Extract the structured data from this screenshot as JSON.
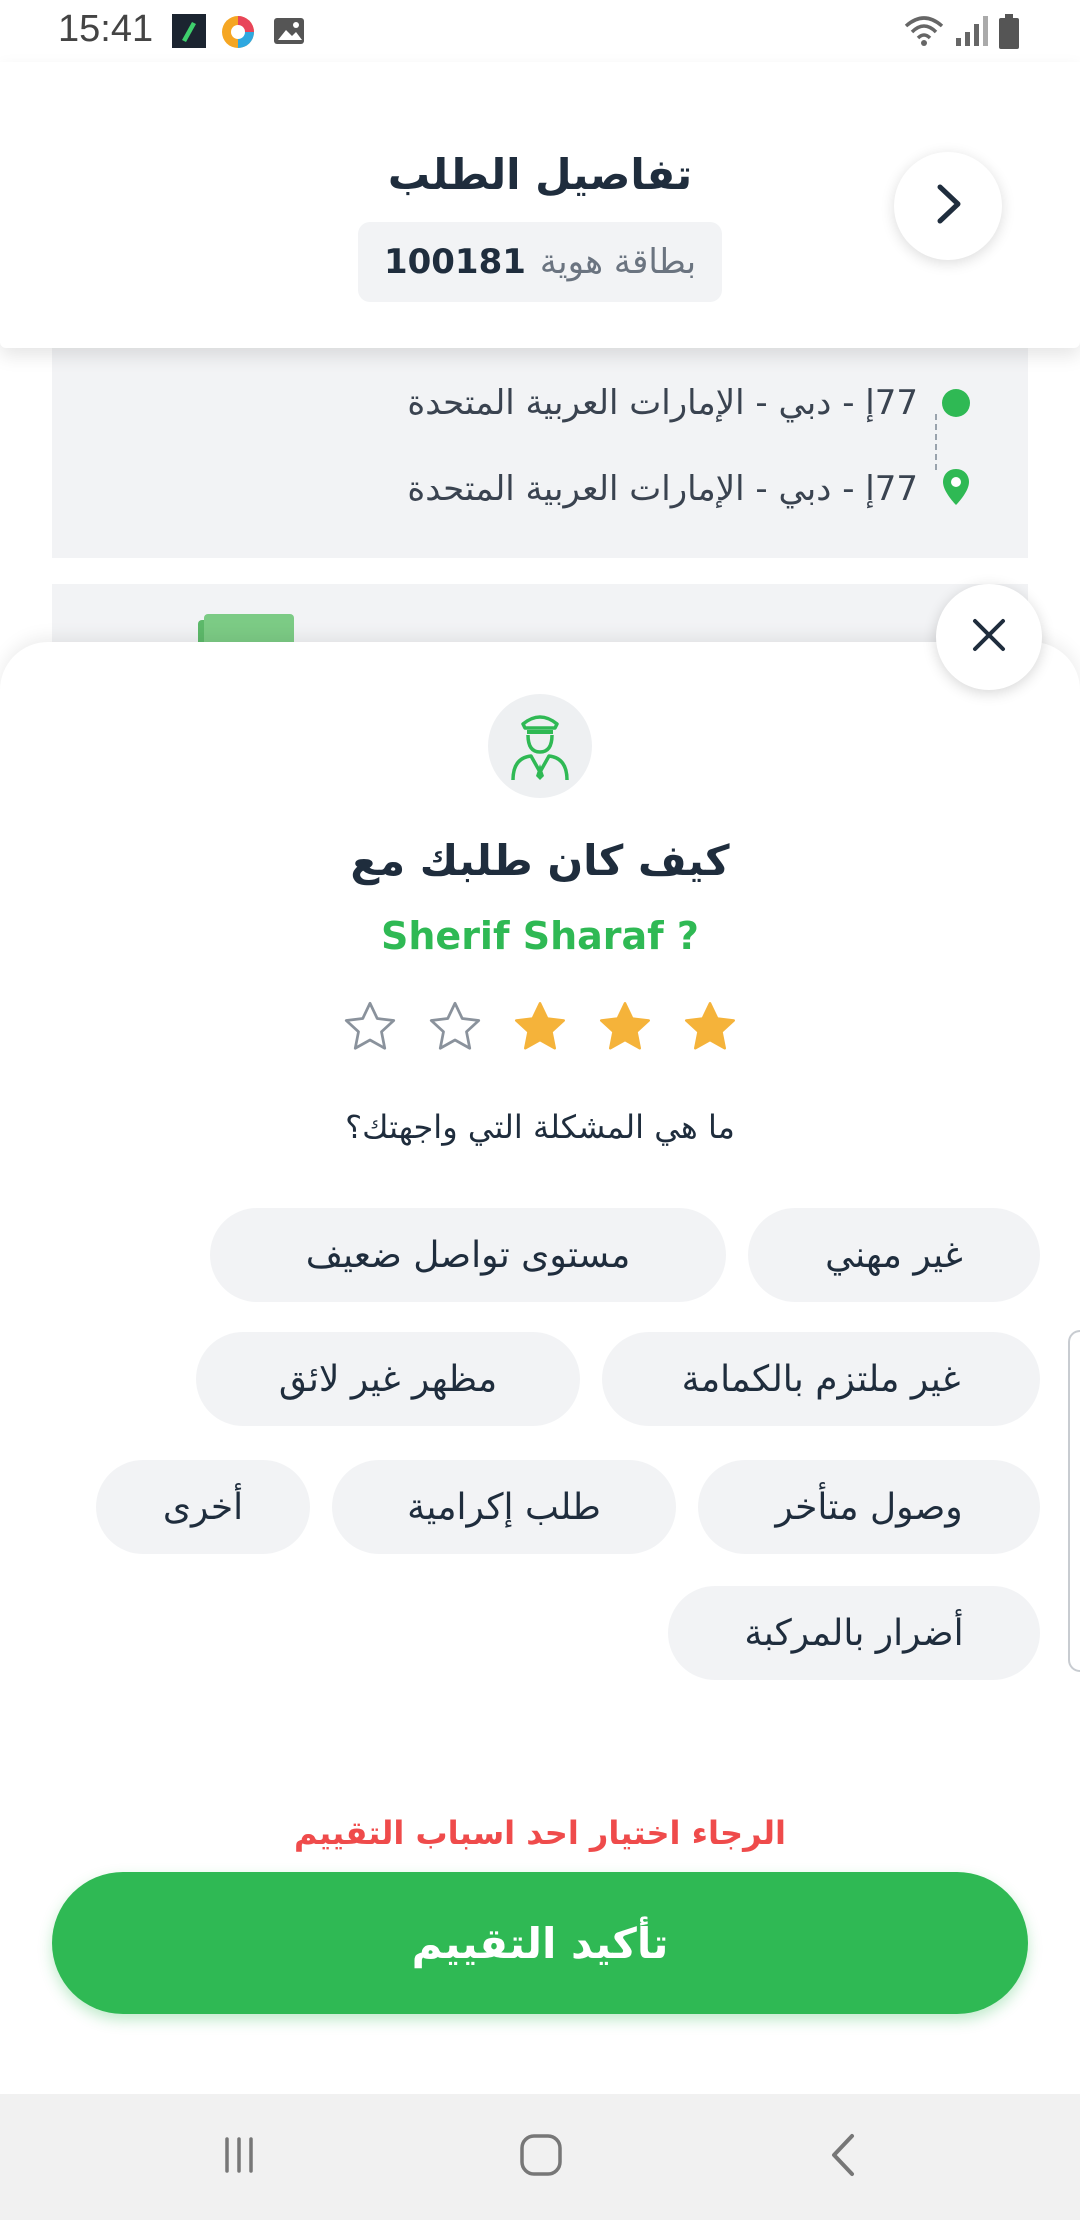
{
  "status_bar": {
    "time": "15:41",
    "left_icons": [
      "app-icon",
      "browser-icon",
      "gallery-icon"
    ],
    "right_icons": [
      "wifi-icon",
      "signal-icon",
      "battery-icon"
    ]
  },
  "header": {
    "title": "تفاصيل الطلب",
    "badge_label": "بطاقة هوية",
    "badge_number": "100181",
    "back_icon": "chevron-right-icon"
  },
  "route": {
    "pickup": "77إ - دبي - الإمارات العربية المتحدة",
    "dropoff": "77إ - دبي - الإمارات العربية المتحدة"
  },
  "rating_sheet": {
    "question": "كيف كان طلبك مع",
    "driver_name": "Sherif Sharaf ?",
    "rating": 3,
    "max_rating": 5,
    "problem_question": "ما هي المشكلة التي واجهتك؟",
    "reasons": [
      "غير مهني",
      "مستوى تواصل ضعيف",
      "غير ملتزم بالكمامة",
      "مظهر غير لائق",
      "وصول متأخر",
      "طلب إكرامية",
      "أخرى",
      "أضرار بالمركبة"
    ],
    "error_message": "الرجاء اختيار احد اسباب التقييم",
    "confirm_label": "تأكيد التقييم"
  },
  "colors": {
    "accent": "#2fb954",
    "star_filled": "#f5b33a",
    "error": "#ef4b4b",
    "chip_bg": "#f2f3f5"
  }
}
